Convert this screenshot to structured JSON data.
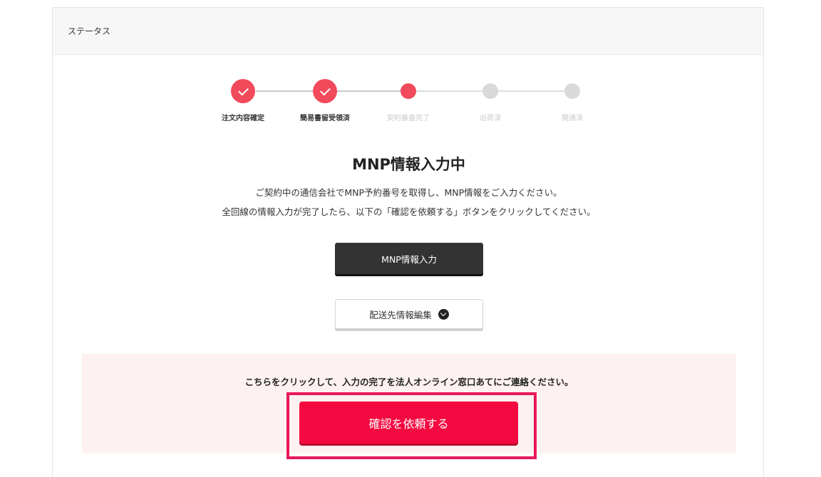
{
  "header": {
    "title": "ステータス"
  },
  "stepper": {
    "steps": [
      {
        "label": "注文内容確定",
        "state": "done"
      },
      {
        "label": "簡易書留受領済",
        "state": "done"
      },
      {
        "label": "契約審査完了",
        "state": "current"
      },
      {
        "label": "出荷済",
        "state": "todo"
      },
      {
        "label": "開通済",
        "state": "todo"
      }
    ]
  },
  "main": {
    "status_title": "MNP情報入力中",
    "description_line1": "ご契約中の通信会社でMNP予約番号を取得し、MNP情報をご入力ください。",
    "description_line2": "全回線の情報入力が完了したら、以下の「確認を依頼する」ボタンをクリックしてください。",
    "mnp_button_label": "MNP情報入力",
    "shipping_button_label": "配送先情報編集"
  },
  "notice": {
    "text": "こちらをクリックして、入力の完了を法人オンライン窓口あてにご連絡ください。",
    "request_button_label": "確認を依頼する"
  },
  "colors": {
    "accent": "#f14a5a",
    "request_button": "#f40a40",
    "highlight_frame": "#e8175d",
    "dark_button": "#333333",
    "notice_bg": "#fdf1f1"
  }
}
